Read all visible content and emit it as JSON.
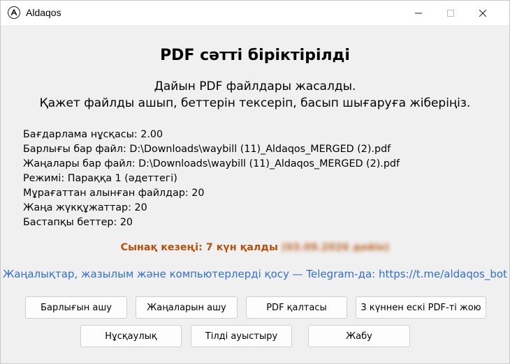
{
  "window": {
    "title": "Aldaqos",
    "icon": "aldaqos-logo-icon",
    "controls": {
      "minimize": "minimize-icon",
      "maximize": "maximize-icon",
      "close": "close-icon"
    }
  },
  "main": {
    "heading": "PDF сәтті біріктірілді",
    "subtitle_line1": "Дайын PDF файлдары жасалды.",
    "subtitle_line2": "Қажет файлды ашып, беттерін тексеріп, басып шығаруға жіберіңіз.",
    "info": [
      "Бағдарлама нұсқасы: 2.00",
      "Барлығы бар файл: D:\\Downloads\\waybill (11)_Aldaqos_MERGED (2).pdf",
      "Жаңалары бар файл: D:\\Downloads\\waybill (11)_Aldaqos_MERGED (2).pdf",
      "Режимі: Параққа 1 (әдеттегі)",
      "Мұрағаттан алынған файлдар: 20",
      "Жаңа жүкқұжаттар: 20",
      "Бастапқы беттер: 20"
    ],
    "trial_text": "Сынақ кезеңі: 7 күн қалды",
    "trial_redacted": "(03.09.2026 дейін)",
    "news_text": "Жаңалықтар, жазылым және компьютерлерді қосу — Telegram-да: https://t.me/aldaqos_bot"
  },
  "buttons": {
    "open_all": "Барлығын ашу",
    "open_new": "Жаңаларын ашу",
    "pdf_folder": "PDF қалтасы",
    "delete_old": "3 күннен ескі PDF-ті жою",
    "guide": "Нұсқаулық",
    "switch_lang": "Тілді ауыстыру",
    "close": "Жабу"
  },
  "colors": {
    "trial": "#b8500a",
    "link": "#2f6fd6"
  }
}
